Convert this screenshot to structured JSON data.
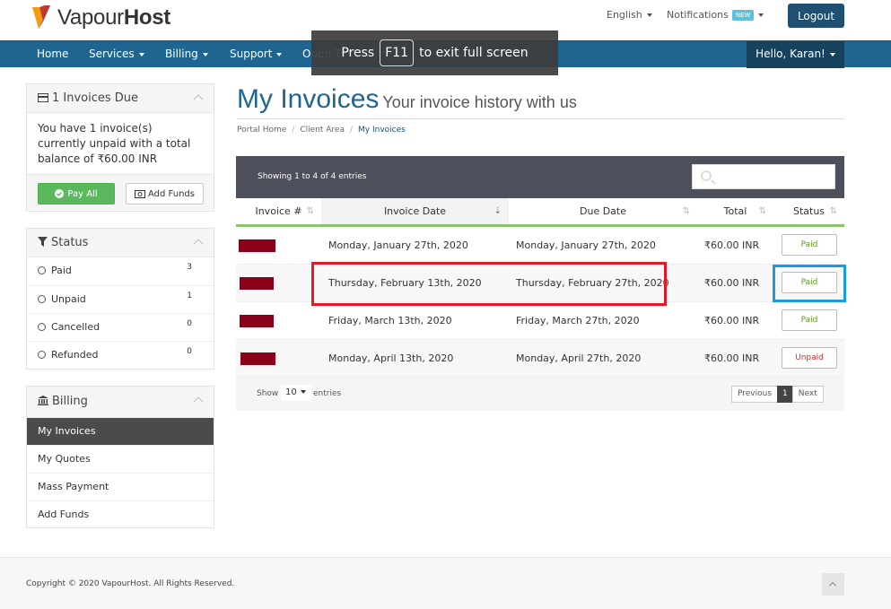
{
  "header": {
    "brand_light": "Vapour",
    "brand_bold": "Host",
    "language": "English",
    "notifications": "Notifications",
    "new_badge": "NEW",
    "logout": "Logout"
  },
  "nav": {
    "items": [
      "Home",
      "Services",
      "Billing",
      "Support",
      "Open Ti"
    ],
    "user": "Hello, Karan!"
  },
  "fullscreen": {
    "before": "Press",
    "key": "F11",
    "after": "to exit full screen"
  },
  "sidebar": {
    "due_panel": {
      "title": "1 Invoices Due",
      "text": "You have 1 invoice(s) currently unpaid with a total balance of ₹60.00 INR",
      "pay_all": "Pay All",
      "add_funds": "Add Funds"
    },
    "status_panel": {
      "title": "Status",
      "items": [
        {
          "label": "Paid",
          "count": "3"
        },
        {
          "label": "Unpaid",
          "count": "1"
        },
        {
          "label": "Cancelled",
          "count": "0"
        },
        {
          "label": "Refunded",
          "count": "0"
        }
      ]
    },
    "billing_panel": {
      "title": "Billing",
      "items": [
        "My Invoices",
        "My Quotes",
        "Mass Payment",
        "Add Funds"
      ]
    }
  },
  "main": {
    "title": "My Invoices",
    "subtitle": "Your invoice history with us",
    "breadcrumb": [
      "Portal Home",
      "Client Area",
      "My Invoices"
    ],
    "table": {
      "info": "Showing 1 to 4 of 4 entries",
      "columns": [
        "Invoice #",
        "Invoice Date",
        "Due Date",
        "Total",
        "Status"
      ],
      "rows": [
        {
          "invoice_date": "Monday, January 27th, 2020",
          "due_date": "Monday, January 27th, 2020",
          "total": "₹60.00 INR",
          "status": "Paid"
        },
        {
          "invoice_date": "Thursday, February 13th, 2020",
          "due_date": "Thursday, February 27th, 2020",
          "total": "₹60.00 INR",
          "status": "Paid"
        },
        {
          "invoice_date": "Friday, March 13th, 2020",
          "due_date": "Friday, March 27th, 2020",
          "total": "₹60.00 INR",
          "status": "Paid"
        },
        {
          "invoice_date": "Monday, April 13th, 2020",
          "due_date": "Monday, April 27th, 2020",
          "total": "₹60.00 INR",
          "status": "Unpaid"
        }
      ],
      "length_label": "Show",
      "length_value": "10",
      "length_after": "entries",
      "pager": {
        "previous": "Previous",
        "current": "1",
        "next": "Next"
      }
    }
  },
  "footer": {
    "copyright": "Copyright © 2020 VapourHost. All Rights Reserved."
  },
  "colors": {
    "brand_blue": "#1e6591",
    "nav_dark": "#16425e",
    "paid_green": "#5a9c1e",
    "unpaid_red": "#c9302c",
    "invoice_redacted": "#8b0019",
    "highlight_red": "#e01b24",
    "highlight_blue": "#1a9be0"
  }
}
